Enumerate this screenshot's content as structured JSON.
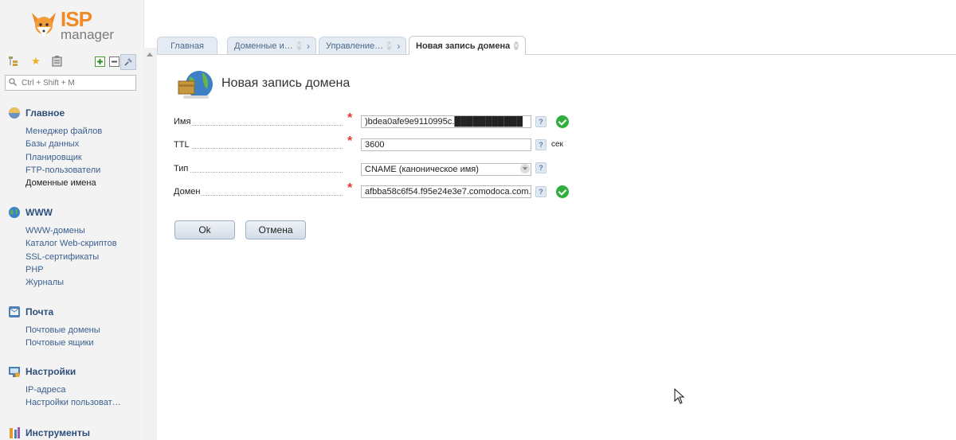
{
  "logo": {
    "brand": "ISP",
    "product": "manager"
  },
  "search": {
    "placeholder": "Ctrl + Shift + M"
  },
  "sidebar": {
    "groups": [
      {
        "title": "Главное",
        "items": [
          "Менеджер файлов",
          "Базы данных",
          "Планировщик",
          "FTP-пользователи",
          "Доменные имена"
        ],
        "active_item": "Доменные имена"
      },
      {
        "title": "WWW",
        "items": [
          "WWW-домены",
          "Каталог Web-скриптов",
          "SSL-сертификаты",
          "PHP",
          "Журналы"
        ]
      },
      {
        "title": "Почта",
        "items": [
          "Почтовые домены",
          "Почтовые ящики"
        ]
      },
      {
        "title": "Настройки",
        "items": [
          "IP-адреса",
          "Настройки пользоват…"
        ]
      },
      {
        "title": "Инструменты",
        "items": []
      }
    ]
  },
  "tabs": [
    {
      "label": "Главная"
    },
    {
      "label": "Доменные и…"
    },
    {
      "label": "Управление…"
    },
    {
      "label": "Новая запись домена"
    }
  ],
  "page": {
    "title": "Новая запись домена"
  },
  "form": {
    "name": {
      "label": "Имя",
      "value": ")bdea0afe9e9110995c.███████████"
    },
    "ttl": {
      "label": "TTL",
      "value": "3600",
      "unit": "сек"
    },
    "type": {
      "label": "Тип",
      "value": "CNAME (каноническое имя)"
    },
    "domain": {
      "label": "Домен",
      "value": "afbba58c6f54.f95e24e3e7.comodoca.com."
    },
    "help_mark": "?"
  },
  "buttons": {
    "ok": "Ok",
    "cancel": "Отмена"
  },
  "colors": {
    "accent_orange": "#f08a24",
    "link_blue": "#3a5f8f",
    "required_red": "#e23a2e",
    "ok_green": "#2fae3e"
  }
}
